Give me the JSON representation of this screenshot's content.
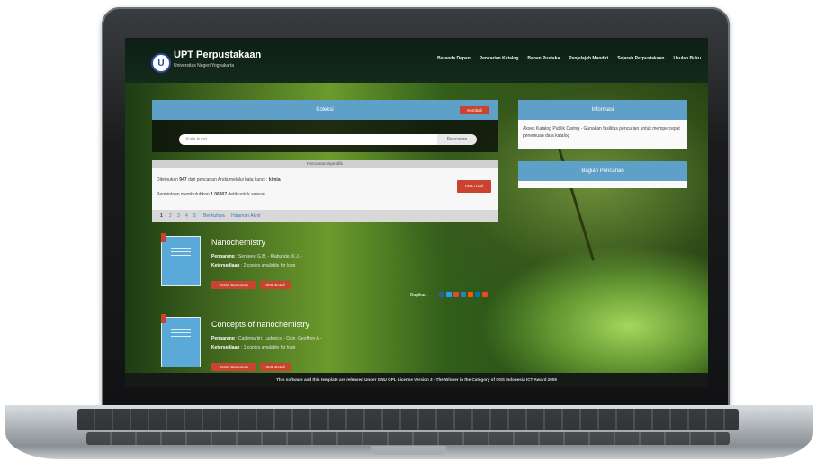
{
  "site": {
    "logo_letter": "U",
    "title": "UPT Perpustakaan",
    "subtitle": "Universitas Negeri Yogyakarta"
  },
  "nav": [
    "Beranda Depan",
    "Pencarian Katalog",
    "Bahan Pustaka",
    "Penjelajah Mandiri",
    "Sejarah Perpustakaan",
    "Usulan Buku"
  ],
  "koleksi": {
    "title": "Koleksi",
    "back_label": "Kembali",
    "search_placeholder": "Kata kunci",
    "search_button": "Pencarian",
    "specific_search": "Pencarian Spesifik",
    "result_prefix": "Ditemukan",
    "result_count": "947",
    "result_middle": "dari pencarian Anda melalui kata kunci :",
    "result_keyword": "kimia",
    "time_prefix": "Permintaan membutuhkan",
    "time_value": "1.06807",
    "time_suffix": "detik untuk selesai",
    "xml_button": "XML Hasil",
    "pages": [
      "1",
      "2",
      "3",
      "4",
      "5"
    ],
    "next_label": "Berikutnya",
    "last_label": "Halaman Akhir"
  },
  "results": [
    {
      "title": "Nanochemistry",
      "author_label": "Pengarang",
      "author": "Sergeev, G.B. - Klabunde, K.J. -",
      "availability_label": "Ketersediaan",
      "availability": "2 copies available for loan",
      "detail_button": "Detail Cantuman",
      "xml_button": "XML Detail"
    },
    {
      "title": "Concepts of nanochemistry",
      "author_label": "Pengarang",
      "author": "Cademartiri, Ludovico - Ozin, Geoffrey A -",
      "availability_label": "Ketersediaan",
      "availability": "1 copies available for loan",
      "detail_button": "Detail Cantuman",
      "xml_button": "XML Detail"
    }
  ],
  "share": {
    "label": "Bagikan:",
    "icons": [
      "facebook-icon",
      "twitter-icon",
      "googleplus-icon",
      "digg-icon",
      "reddit-icon",
      "linkedin-icon",
      "stumbleupon-icon"
    ],
    "colors": [
      "#3b5998",
      "#1da1f2",
      "#dd4b39",
      "#3d7ab8",
      "#ff5700",
      "#0077b5",
      "#eb4924"
    ]
  },
  "informasi": {
    "title": "Informasi",
    "text": "Akses Katalog Publik Daring - Gunakan fasilitas pencarian untuk mempercepat penemuan data katalog"
  },
  "guide": {
    "title": "Bagian Pencarian"
  },
  "footer": "This software and this template are released Under GNU GPL License Version 3 - The Winner in the Category of OSS Indonesia ICT Award 2009"
}
